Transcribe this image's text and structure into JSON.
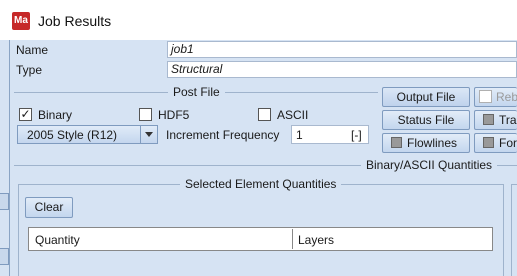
{
  "window": {
    "title": "Job Results",
    "app_icon": "Ma"
  },
  "job": {
    "name_label": "Name",
    "name_value": "job1",
    "type_label": "Type",
    "type_value": "Structural"
  },
  "post_file": {
    "section_label": "Post File",
    "binary_label": "Binary",
    "binary_checked": true,
    "hdf5_label": "HDF5",
    "hdf5_checked": false,
    "ascii_label": "ASCII",
    "ascii_checked": false,
    "style_value": "2005 Style (R12)",
    "increment_label": "Increment Frequency",
    "increment_value": "1",
    "increment_unit": "[-]"
  },
  "side_buttons": {
    "output_file": "Output File",
    "status_file": "Status File",
    "flowlines": "Flowlines",
    "rebar": "Reba",
    "tracking": "Trac",
    "forces": "Forc"
  },
  "quantities": {
    "section_label": "Binary/ASCII Quantities",
    "element_section_label": "Selected Element Quantities",
    "clear_label": "Clear",
    "columns": [
      "Quantity",
      "Layers"
    ]
  },
  "colors": {
    "accent": "#c62828",
    "panel": "#d6e3f3",
    "border": "#7f9bbf"
  }
}
